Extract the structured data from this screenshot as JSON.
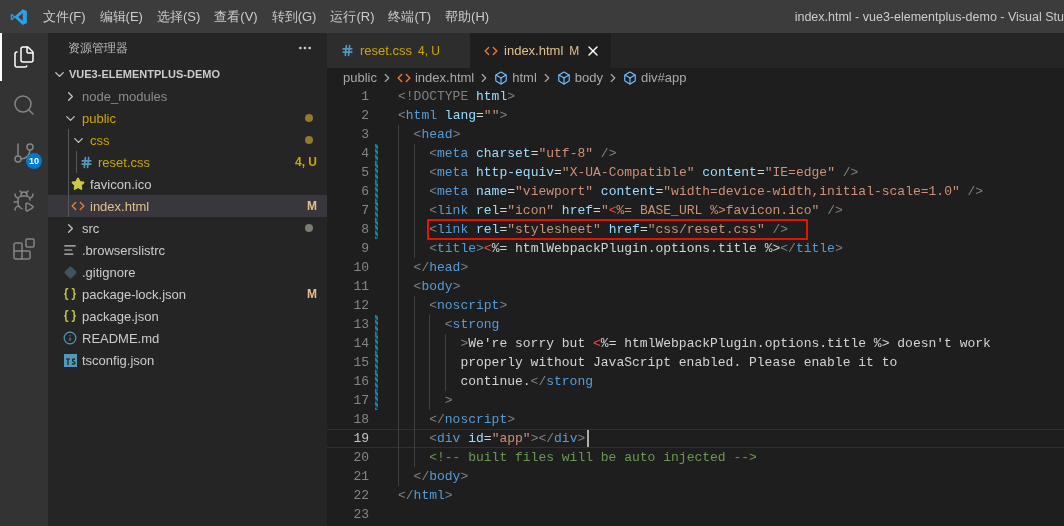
{
  "title_bar": {
    "menu": [
      "文件(F)",
      "编辑(E)",
      "选择(S)",
      "查看(V)",
      "转到(G)",
      "运行(R)",
      "终端(T)",
      "帮助(H)"
    ],
    "title": "index.html - vue3-elementplus-demo - Visual Stu"
  },
  "activity_bar": [
    {
      "kind": "explorer",
      "selected": true
    },
    {
      "kind": "search",
      "selected": false
    },
    {
      "kind": "source-control",
      "selected": false,
      "badge": "10"
    },
    {
      "kind": "run-debug",
      "selected": false
    },
    {
      "kind": "extensions",
      "selected": false
    }
  ],
  "sidebar": {
    "title": "资源管理器",
    "root": {
      "label": "VUE3-ELEMENTPLUS-DEMO",
      "expanded": true
    },
    "items": [
      {
        "label": "node_modules",
        "kind": "folder",
        "expanded": false,
        "dimmed": true,
        "warning": false,
        "modified": false,
        "selected": false
      },
      {
        "label": "public",
        "kind": "folder",
        "expanded": true,
        "dimmed": false,
        "warning": true,
        "modified": false,
        "color": "#8d7b2f",
        "selected": false,
        "children": [
          {
            "label": "css",
            "kind": "folder",
            "expanded": true,
            "dimmed": false,
            "warning": true,
            "modified": false,
            "color": "#8d7b2f",
            "selected": false,
            "children": [
              {
                "label": "reset.css",
                "kind": "css",
                "dimmed": false,
                "warning": true,
                "modified": false,
                "badge": "4, U",
                "selected": false
              }
            ]
          },
          {
            "label": "favicon.ico",
            "kind": "image",
            "dimmed": false,
            "warning": false,
            "modified": false,
            "selected": false
          },
          {
            "label": "index.html",
            "kind": "html",
            "dimmed": false,
            "warning": false,
            "modified": true,
            "badge": "M",
            "selected": true
          }
        ]
      },
      {
        "label": "src",
        "kind": "folder",
        "expanded": false,
        "dimmed": false,
        "warning": false,
        "modified": false,
        "color": "#7d7a72",
        "selected": false
      },
      {
        "label": ".browserslistrc",
        "kind": "text",
        "dimmed": false,
        "warning": false,
        "modified": false,
        "selected": false
      },
      {
        "label": ".gitignore",
        "kind": "git",
        "dimmed": false,
        "warning": false,
        "modified": false,
        "selected": false
      },
      {
        "label": "package-lock.json",
        "kind": "json",
        "dimmed": false,
        "warning": false,
        "modified": false,
        "badge": "M",
        "selected": false
      },
      {
        "label": "package.json",
        "kind": "json",
        "dimmed": false,
        "warning": false,
        "modified": false,
        "selected": false
      },
      {
        "label": "README.md",
        "kind": "info",
        "dimmed": false,
        "warning": false,
        "modified": false,
        "selected": false
      },
      {
        "label": "tsconfig.json",
        "kind": "ts",
        "dimmed": false,
        "warning": false,
        "modified": false,
        "selected": false
      }
    ]
  },
  "tabs": [
    {
      "label": "reset.css",
      "kind": "css",
      "warning": true,
      "modified": false,
      "badge": "4, U",
      "selected": false
    },
    {
      "label": "index.html",
      "kind": "html",
      "warning": false,
      "modified": true,
      "badge": "M",
      "selected": true
    }
  ],
  "breadcrumb": [
    {
      "label": "public",
      "kind": "folder"
    },
    {
      "label": "index.html",
      "kind": "html"
    },
    {
      "label": "html",
      "kind": "element"
    },
    {
      "label": "body",
      "kind": "element"
    },
    {
      "label": "div#app",
      "kind": "element"
    }
  ],
  "editor": {
    "lines": [
      {
        "number": "1",
        "modified": false,
        "highlighted": false,
        "current": false,
        "tokens": [
          {
            "kind": "punct",
            "text": "<!DOCTYPE "
          },
          {
            "kind": "attr",
            "text": "html"
          },
          {
            "kind": "punct",
            "text": ">"
          }
        ]
      },
      {
        "number": "2",
        "modified": false,
        "highlighted": false,
        "current": false,
        "tokens": [
          {
            "kind": "punct",
            "text": "<"
          },
          {
            "kind": "tag",
            "text": "html"
          },
          {
            "kind": "attr",
            "text": " lang"
          },
          {
            "kind": "text",
            "text": "="
          },
          {
            "kind": "string",
            "text": "\"\""
          },
          {
            "kind": "punct",
            "text": ">"
          }
        ]
      },
      {
        "number": "3",
        "modified": false,
        "highlighted": false,
        "current": false,
        "tokens": [
          {
            "kind": "punct",
            "text": "  <"
          },
          {
            "kind": "tag",
            "text": "head"
          },
          {
            "kind": "punct",
            "text": ">"
          }
        ]
      },
      {
        "number": "4",
        "modified": true,
        "highlighted": false,
        "current": false,
        "tokens": [
          {
            "kind": "punct",
            "text": "    <"
          },
          {
            "kind": "tag",
            "text": "meta"
          },
          {
            "kind": "attr",
            "text": " charset"
          },
          {
            "kind": "text",
            "text": "="
          },
          {
            "kind": "string",
            "text": "\"utf-8\""
          },
          {
            "kind": "punct",
            "text": " />"
          }
        ]
      },
      {
        "number": "5",
        "modified": true,
        "highlighted": false,
        "current": false,
        "tokens": [
          {
            "kind": "punct",
            "text": "    <"
          },
          {
            "kind": "tag",
            "text": "meta"
          },
          {
            "kind": "attr",
            "text": " http-equiv"
          },
          {
            "kind": "text",
            "text": "="
          },
          {
            "kind": "string",
            "text": "\"X-UA-Compatible\""
          },
          {
            "kind": "attr",
            "text": " content"
          },
          {
            "kind": "text",
            "text": "="
          },
          {
            "kind": "string",
            "text": "\"IE=edge\""
          },
          {
            "kind": "punct",
            "text": " />"
          }
        ]
      },
      {
        "number": "6",
        "modified": true,
        "highlighted": false,
        "current": false,
        "tokens": [
          {
            "kind": "punct",
            "text": "    <"
          },
          {
            "kind": "tag",
            "text": "meta"
          },
          {
            "kind": "attr",
            "text": " name"
          },
          {
            "kind": "text",
            "text": "="
          },
          {
            "kind": "string",
            "text": "\"viewport\""
          },
          {
            "kind": "attr",
            "text": " content"
          },
          {
            "kind": "text",
            "text": "="
          },
          {
            "kind": "string",
            "text": "\"width=device-width,initial-scale=1.0\""
          },
          {
            "kind": "punct",
            "text": " />"
          }
        ]
      },
      {
        "number": "7",
        "modified": true,
        "highlighted": false,
        "current": false,
        "tokens": [
          {
            "kind": "punct",
            "text": "    <"
          },
          {
            "kind": "tag",
            "text": "link"
          },
          {
            "kind": "attr",
            "text": " rel"
          },
          {
            "kind": "text",
            "text": "="
          },
          {
            "kind": "string",
            "text": "\"icon\""
          },
          {
            "kind": "attr",
            "text": " href"
          },
          {
            "kind": "text",
            "text": "="
          },
          {
            "kind": "string",
            "text": "\""
          },
          {
            "kind": "error",
            "text": "<"
          },
          {
            "kind": "string",
            "text": "%= BASE_URL %>favicon.ico\""
          },
          {
            "kind": "punct",
            "text": " />"
          }
        ]
      },
      {
        "number": "8",
        "modified": true,
        "highlighted": true,
        "current": false,
        "tokens": [
          {
            "kind": "punct",
            "text": "    <"
          },
          {
            "kind": "tag",
            "text": "link"
          },
          {
            "kind": "attr",
            "text": " rel"
          },
          {
            "kind": "text",
            "text": "="
          },
          {
            "kind": "string",
            "text": "\"stylesheet\""
          },
          {
            "kind": "attr",
            "text": " href"
          },
          {
            "kind": "text",
            "text": "="
          },
          {
            "kind": "string",
            "text": "\"css/reset.css\""
          },
          {
            "kind": "punct",
            "text": " />"
          }
        ]
      },
      {
        "number": "9",
        "modified": false,
        "highlighted": false,
        "current": false,
        "tokens": [
          {
            "kind": "punct",
            "text": "    <"
          },
          {
            "kind": "tag",
            "text": "title"
          },
          {
            "kind": "punct",
            "text": ">"
          },
          {
            "kind": "error",
            "text": "<"
          },
          {
            "kind": "text",
            "text": "%= htmlWebpackPlugin.options.title %>"
          },
          {
            "kind": "punct",
            "text": "</"
          },
          {
            "kind": "tag",
            "text": "title"
          },
          {
            "kind": "punct",
            "text": ">"
          }
        ]
      },
      {
        "number": "10",
        "modified": false,
        "highlighted": false,
        "current": false,
        "tokens": [
          {
            "kind": "punct",
            "text": "  </"
          },
          {
            "kind": "tag",
            "text": "head"
          },
          {
            "kind": "punct",
            "text": ">"
          }
        ]
      },
      {
        "number": "11",
        "modified": false,
        "highlighted": false,
        "current": false,
        "tokens": [
          {
            "kind": "punct",
            "text": "  <"
          },
          {
            "kind": "tag",
            "text": "body"
          },
          {
            "kind": "punct",
            "text": ">"
          }
        ]
      },
      {
        "number": "12",
        "modified": false,
        "highlighted": false,
        "current": false,
        "tokens": [
          {
            "kind": "punct",
            "text": "    <"
          },
          {
            "kind": "tag",
            "text": "noscript"
          },
          {
            "kind": "punct",
            "text": ">"
          }
        ]
      },
      {
        "number": "13",
        "modified": true,
        "highlighted": false,
        "current": false,
        "tokens": [
          {
            "kind": "punct",
            "text": "      <"
          },
          {
            "kind": "tag",
            "text": "strong"
          }
        ]
      },
      {
        "number": "14",
        "modified": true,
        "highlighted": false,
        "current": false,
        "tokens": [
          {
            "kind": "punct",
            "text": "        >"
          },
          {
            "kind": "text",
            "text": "We're sorry but "
          },
          {
            "kind": "error",
            "text": "<"
          },
          {
            "kind": "text",
            "text": "%= htmlWebpackPlugin.options.title %> doesn't work"
          }
        ]
      },
      {
        "number": "15",
        "modified": true,
        "highlighted": false,
        "current": false,
        "tokens": [
          {
            "kind": "text",
            "text": "        properly without JavaScript enabled. Please enable it to"
          }
        ]
      },
      {
        "number": "16",
        "modified": true,
        "highlighted": false,
        "current": false,
        "tokens": [
          {
            "kind": "text",
            "text": "        continue."
          },
          {
            "kind": "punct",
            "text": "</"
          },
          {
            "kind": "tag",
            "text": "strong"
          }
        ]
      },
      {
        "number": "17",
        "modified": true,
        "highlighted": false,
        "current": false,
        "tokens": [
          {
            "kind": "punct",
            "text": "      >"
          }
        ]
      },
      {
        "number": "18",
        "modified": false,
        "highlighted": false,
        "current": false,
        "tokens": [
          {
            "kind": "punct",
            "text": "    </"
          },
          {
            "kind": "tag",
            "text": "noscript"
          },
          {
            "kind": "punct",
            "text": ">"
          }
        ]
      },
      {
        "number": "19",
        "modified": false,
        "highlighted": false,
        "current": true,
        "tokens": [
          {
            "kind": "punct",
            "text": "    <"
          },
          {
            "kind": "tag",
            "text": "div"
          },
          {
            "kind": "attr",
            "text": " id"
          },
          {
            "kind": "text",
            "text": "="
          },
          {
            "kind": "string",
            "text": "\"app\""
          },
          {
            "kind": "punct",
            "text": "></"
          },
          {
            "kind": "tag",
            "text": "div"
          },
          {
            "kind": "punct",
            "text": ">"
          }
        ]
      },
      {
        "number": "20",
        "modified": false,
        "highlighted": false,
        "current": false,
        "tokens": [
          {
            "kind": "comment",
            "text": "    <!-- built files will be auto injected -->"
          }
        ]
      },
      {
        "number": "21",
        "modified": false,
        "highlighted": false,
        "current": false,
        "tokens": [
          {
            "kind": "punct",
            "text": "  </"
          },
          {
            "kind": "tag",
            "text": "body"
          },
          {
            "kind": "punct",
            "text": ">"
          }
        ]
      },
      {
        "number": "22",
        "modified": false,
        "highlighted": false,
        "current": false,
        "tokens": [
          {
            "kind": "punct",
            "text": "</"
          },
          {
            "kind": "tag",
            "text": "html"
          },
          {
            "kind": "punct",
            "text": ">"
          }
        ]
      },
      {
        "number": "23",
        "modified": false,
        "highlighted": false,
        "current": false
      }
    ]
  }
}
